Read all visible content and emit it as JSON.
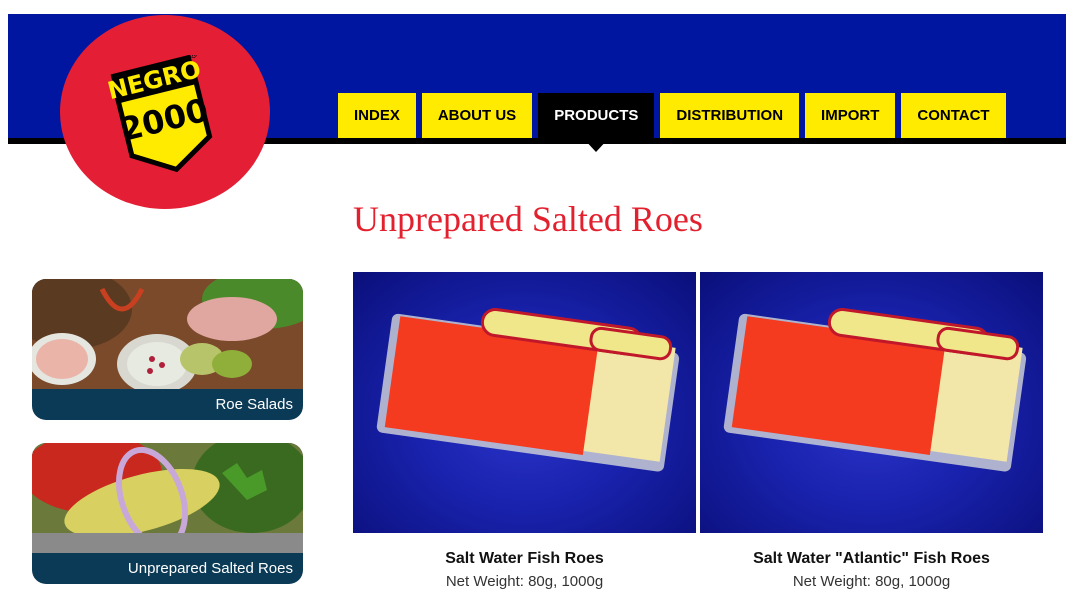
{
  "brand": {
    "logo_text_top": "NEGRO",
    "logo_text_bottom": "2000",
    "logo_mark": "®",
    "red": "#e41f35",
    "yellow": "#ffeb00",
    "blue": "#0016a0"
  },
  "nav": {
    "items": [
      {
        "label": "INDEX",
        "active": false
      },
      {
        "label": "ABOUT US",
        "active": false
      },
      {
        "label": "PRODUCTS",
        "active": true
      },
      {
        "label": "DISTRIBUTION",
        "active": false
      },
      {
        "label": "IMPORT",
        "active": false
      },
      {
        "label": "CONTACT",
        "active": false
      }
    ]
  },
  "page": {
    "title": "Unprepared Salted Roes"
  },
  "sidebar": {
    "items": [
      {
        "label": "Roe Salads"
      },
      {
        "label": "Unprepared Salted Roes"
      }
    ]
  },
  "products": [
    {
      "name": "Salt Water Fish Roes",
      "weight": "Net Weight: 80g, 1000g"
    },
    {
      "name": "Salt Water \"Atlantic\" Fish Roes",
      "weight": "Net Weight: 80g, 1000g"
    }
  ]
}
